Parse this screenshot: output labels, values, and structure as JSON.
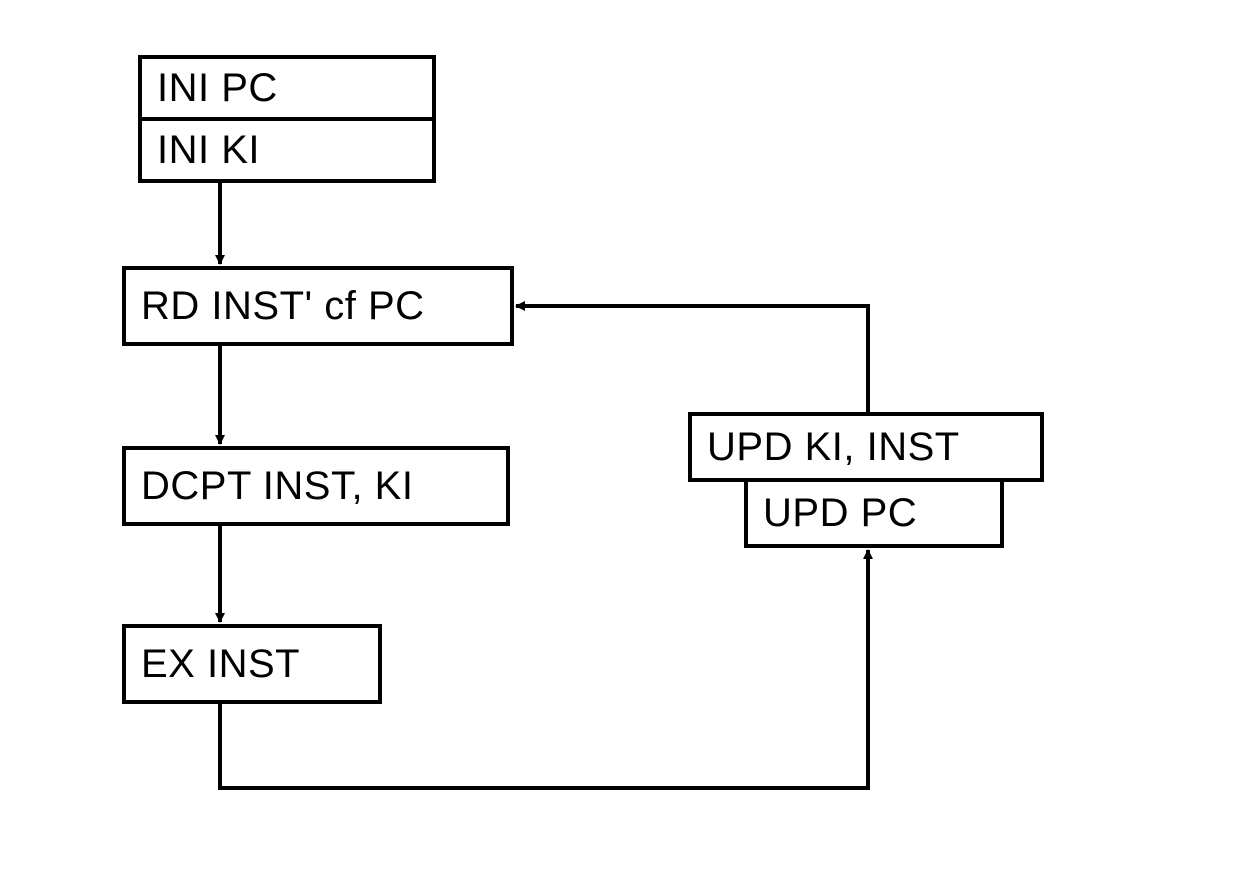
{
  "boxes": {
    "ini_pc": {
      "label": "INI PC"
    },
    "ini_ki": {
      "label": "INI KI"
    },
    "rd_inst": {
      "label": "RD INST' cf PC"
    },
    "dcpt": {
      "label": "DCPT INST, KI"
    },
    "ex_inst": {
      "label": "EX INST"
    },
    "upd_ki": {
      "label": "UPD KI, INST"
    },
    "upd_pc": {
      "label": "UPD PC"
    }
  }
}
